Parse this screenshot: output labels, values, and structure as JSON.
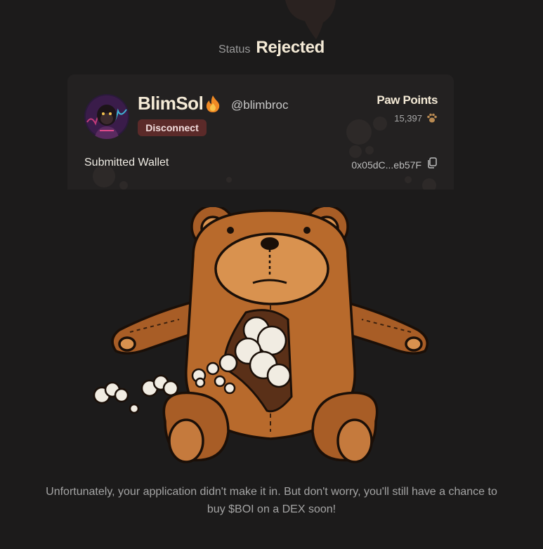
{
  "status": {
    "label": "Status",
    "value": "Rejected"
  },
  "profile": {
    "username": "BlimSol",
    "handle": "@blimbroc",
    "disconnect_label": "Disconnect",
    "avatar_icon": "gorilla-avatar-icon",
    "badge_icon": "fire-icon"
  },
  "paw_points": {
    "title": "Paw Points",
    "value": "15,397",
    "icon": "paw-icon"
  },
  "wallet": {
    "label": "Submitted Wallet",
    "value": "0x05dC...eb57F",
    "copy_icon": "copy-icon"
  },
  "illustration": {
    "name": "torn-teddy-bear-illustration"
  },
  "message": "Unfortunately, your application didn't make it in. But don't worry, you'll still have a chance to buy $BOI on a DEX soon!",
  "colors": {
    "background": "#1c1b1b",
    "card": "#232121",
    "accent_text": "#f4ead6",
    "disconnect_bg": "#5b2a29",
    "bear_brown": "#b86a2c"
  }
}
